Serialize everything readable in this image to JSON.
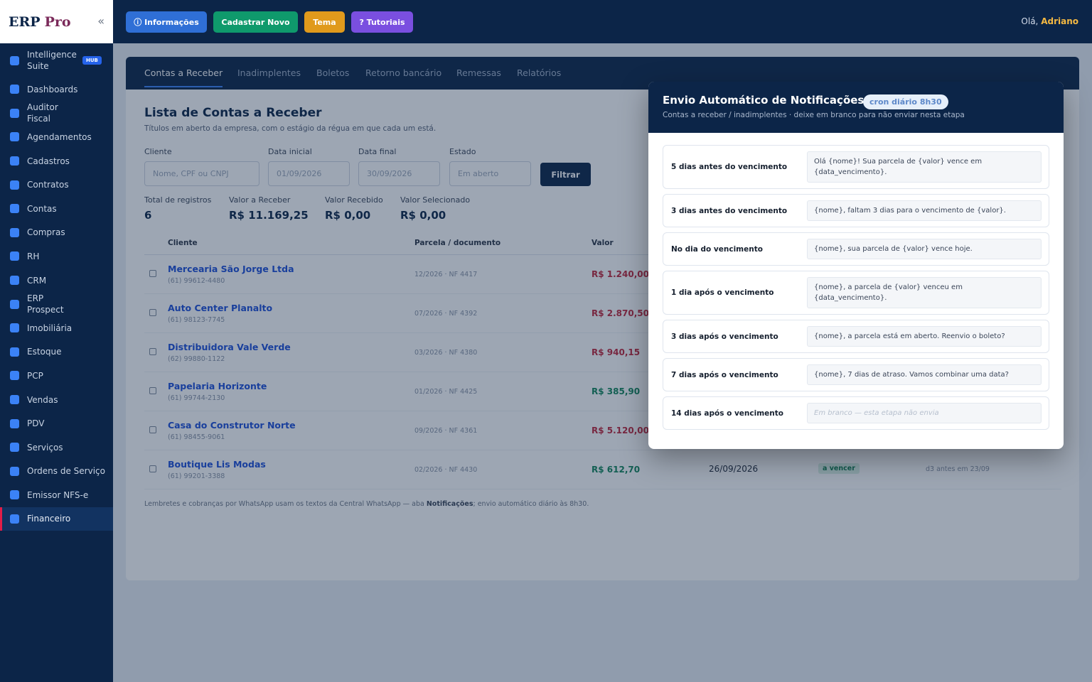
{
  "brand": {
    "erp": "ERP",
    "pro": "Pro",
    "collapse_icon": "«"
  },
  "sidebar": {
    "items": [
      {
        "label": "Intelligence Suite",
        "badge": "HUB"
      },
      {
        "label": "Dashboards"
      },
      {
        "label": "Auditor Fiscal"
      },
      {
        "label": "Agendamentos"
      },
      {
        "label": "Cadastros"
      },
      {
        "label": "Contratos"
      },
      {
        "label": "Contas"
      },
      {
        "label": "Compras"
      },
      {
        "label": "RH"
      },
      {
        "label": "CRM"
      },
      {
        "label": "ERP Prospect"
      },
      {
        "label": "Imobiliária"
      },
      {
        "label": "Estoque"
      },
      {
        "label": "PCP"
      },
      {
        "label": "Vendas"
      },
      {
        "label": "PDV"
      },
      {
        "label": "Serviços"
      },
      {
        "label": "Ordens de Serviço"
      },
      {
        "label": "Emissor NFS-e"
      },
      {
        "label": "Financeiro"
      }
    ]
  },
  "topbar": {
    "buttons": [
      {
        "label": "ⓘ Informações",
        "color": "#2f6fd6"
      },
      {
        "label": "Cadastrar Novo",
        "color": "#0f9a6c"
      },
      {
        "label": "Tema",
        "color": "#e09a1c"
      },
      {
        "label": "? Tutoriais",
        "color": "#7a4fe0"
      }
    ],
    "greeting": "Olá,",
    "user": "Adriano"
  },
  "tabs": [
    "Contas a Receber",
    "Inadimplentes",
    "Boletos",
    "Retorno bancário",
    "Remessas",
    "Relatórios"
  ],
  "page": {
    "title": "Lista de Contas a Receber",
    "subtitle": "Títulos em aberto da empresa, com o estágio da régua em que cada um está."
  },
  "filters": {
    "cliente_label": "Cliente",
    "cliente_placeholder": "Nome, CPF ou CNPJ",
    "data_inicial_label": "Data inicial",
    "data_inicial_value": "01/09/2026",
    "data_final_label": "Data final",
    "data_final_value": "30/09/2026",
    "estado_label": "Estado",
    "estado_value": "Em aberto",
    "filter_button": "Filtrar"
  },
  "stats": [
    {
      "label": "Total de registros",
      "value": "6"
    },
    {
      "label": "Valor a Receber",
      "value": "R$ 11.169,25"
    },
    {
      "label": "Valor Recebido",
      "value": "R$ 0,00"
    },
    {
      "label": "Valor Selecionado",
      "value": "R$ 0,00"
    }
  ],
  "table": {
    "headers": [
      "Cliente",
      "Parcela / documento",
      "Valor"
    ],
    "rows": [
      {
        "cliente": "Mercearia São Jorge Ltda",
        "telefone": "(61) 99612-4480",
        "doc": "12/2026 · NF 4417",
        "valor": "R$ 1.240,00",
        "valor_color": "#c0263b"
      },
      {
        "cliente": "Auto Center Planalto",
        "telefone": "(61) 98123-7745",
        "doc": "07/2026 · NF 4392",
        "valor": "R$ 2.870,50",
        "valor_color": "#c0263b"
      },
      {
        "cliente": "Distribuidora Vale Verde",
        "telefone": "(62) 99880-1122",
        "doc": "03/2026 · NF 4380",
        "valor": "R$ 940,15",
        "valor_color": "#c0263b"
      },
      {
        "cliente": "Papelaria Horizonte",
        "telefone": "(61) 99744-2130",
        "doc": "01/2026 · NF 4425",
        "valor": "R$ 385,90",
        "valor_color": "#12865b"
      },
      {
        "cliente": "Casa do Construtor Norte",
        "telefone": "(61) 98455-9061",
        "doc": "09/2026 · NF 4361",
        "valor": "R$ 5.120,00",
        "valor_color": "#c0263b"
      },
      {
        "cliente": "Boutique Lis Modas",
        "telefone": "(61) 99201-3388",
        "doc": "02/2026 · NF 4430",
        "valor": "R$ 612,70",
        "valor_color": "#12865b",
        "vencimento": "26/09/2026",
        "status": "a vencer",
        "regua": "d3 antes em 23/09"
      }
    ]
  },
  "footer": {
    "text_before": "Lembretes e cobranças por WhatsApp usam os textos da Central WhatsApp — aba ",
    "text_bold": "Notificações",
    "text_after": "; envio automático diário às 8h30."
  },
  "modal": {
    "title": "Envio Automático de Notificações",
    "badge": "cron diário 8h30",
    "subtitle": "Contas a receber / inadimplentes · deixe em branco para não enviar nesta etapa",
    "stages": [
      {
        "label": "5 dias antes do vencimento",
        "text": "Olá {nome}! Sua parcela de {valor} vence em {data_vencimento}."
      },
      {
        "label": "3 dias antes do vencimento",
        "text": "{nome}, faltam 3 dias para o vencimento de {valor}."
      },
      {
        "label": "No dia do vencimento",
        "text": "{nome}, sua parcela de {valor} vence hoje."
      },
      {
        "label": "1 dia após o vencimento",
        "text": "{nome}, a parcela de {valor} venceu em {data_vencimento}."
      },
      {
        "label": "3 dias após o vencimento",
        "text": "{nome}, a parcela está em aberto. Reenvio o boleto?"
      },
      {
        "label": "7 dias após o vencimento",
        "text": "{nome}, 7 dias de atraso. Vamos combinar uma data?"
      },
      {
        "label": "14 dias após o vencimento",
        "text": "",
        "placeholder": "Em branco — esta etapa não envia"
      }
    ]
  }
}
